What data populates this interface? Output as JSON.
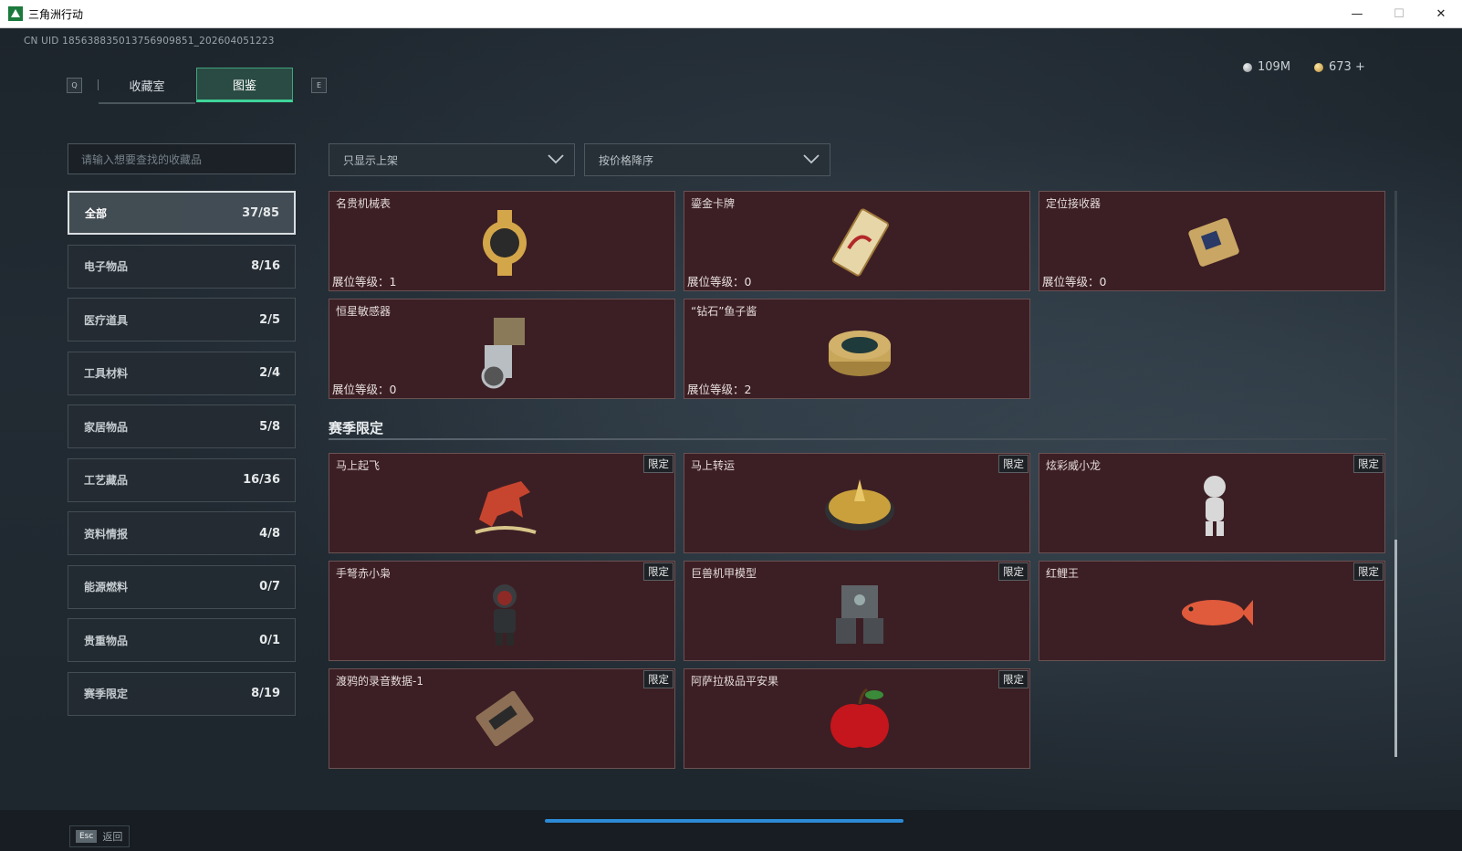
{
  "window": {
    "title": "三角洲行动",
    "minimize": "—",
    "maximize": "☐",
    "close": "✕"
  },
  "uid": "CN UID 185638835013756909851_202604051223",
  "hotkeys": {
    "prev": "Q",
    "next": "E"
  },
  "tabs": [
    {
      "label": "收藏室"
    },
    {
      "label": "图鉴"
    }
  ],
  "currency": {
    "silver": "109M",
    "gold": "673 +"
  },
  "search": {
    "placeholder": "请输入想要查找的收藏品"
  },
  "categories": [
    {
      "label": "全部",
      "count": "37/85"
    },
    {
      "label": "电子物品",
      "count": "8/16"
    },
    {
      "label": "医疗道具",
      "count": "2/5"
    },
    {
      "label": "工具材料",
      "count": "2/4"
    },
    {
      "label": "家居物品",
      "count": "5/8"
    },
    {
      "label": "工艺藏品",
      "count": "16/36"
    },
    {
      "label": "资料情报",
      "count": "4/8"
    },
    {
      "label": "能源燃料",
      "count": "0/7"
    },
    {
      "label": "贵重物品",
      "count": "0/1"
    },
    {
      "label": "赛季限定",
      "count": "8/19"
    }
  ],
  "filters": {
    "display": "只显示上架",
    "sort": "按价格降序"
  },
  "level_label": "展位等级：",
  "limited_label": "限定",
  "items": [
    {
      "name": "名贵机械表",
      "level": "1",
      "icon": "gold-watch-icon",
      "color": "#d4a64a"
    },
    {
      "name": "鎏金卡牌",
      "level": "0",
      "icon": "gold-card-icon",
      "color": "#e6d6a8"
    },
    {
      "name": "定位接收器",
      "level": "0",
      "icon": "gps-receiver-icon",
      "color": "#c9a663"
    },
    {
      "name": "恒星敏感器",
      "level": "0",
      "icon": "star-sensor-icon",
      "color": "#b9bec2"
    },
    {
      "name": "“钻石”鱼子酱",
      "level": "2",
      "icon": "caviar-tin-icon",
      "color": "#c8a65a"
    }
  ],
  "section_title": "赛季限定",
  "season_items": [
    {
      "name": "马上起飞",
      "icon": "red-horse-icon",
      "color": "#c7452f"
    },
    {
      "name": "马上转运",
      "icon": "fortune-wheel-icon",
      "color": "#c9a03c"
    },
    {
      "name": "炫彩威小龙",
      "icon": "dragon-figure-icon",
      "color": "#d8d8d8"
    },
    {
      "name": "手弩赤小枭",
      "icon": "hooded-figure-icon",
      "color": "#8e2a26"
    },
    {
      "name": "巨兽机甲模型",
      "icon": "mech-model-icon",
      "color": "#5f6468"
    },
    {
      "name": "红鲤王",
      "icon": "red-carp-icon",
      "color": "#e05a3c"
    },
    {
      "name": "渡鸦的录音数据-1",
      "icon": "data-drive-icon",
      "color": "#8d6f55"
    },
    {
      "name": "阿萨拉极品平安果",
      "icon": "red-apple-icon",
      "color": "#c4161c"
    }
  ],
  "footer": {
    "esc_key": "Esc",
    "esc_label": "返回"
  }
}
